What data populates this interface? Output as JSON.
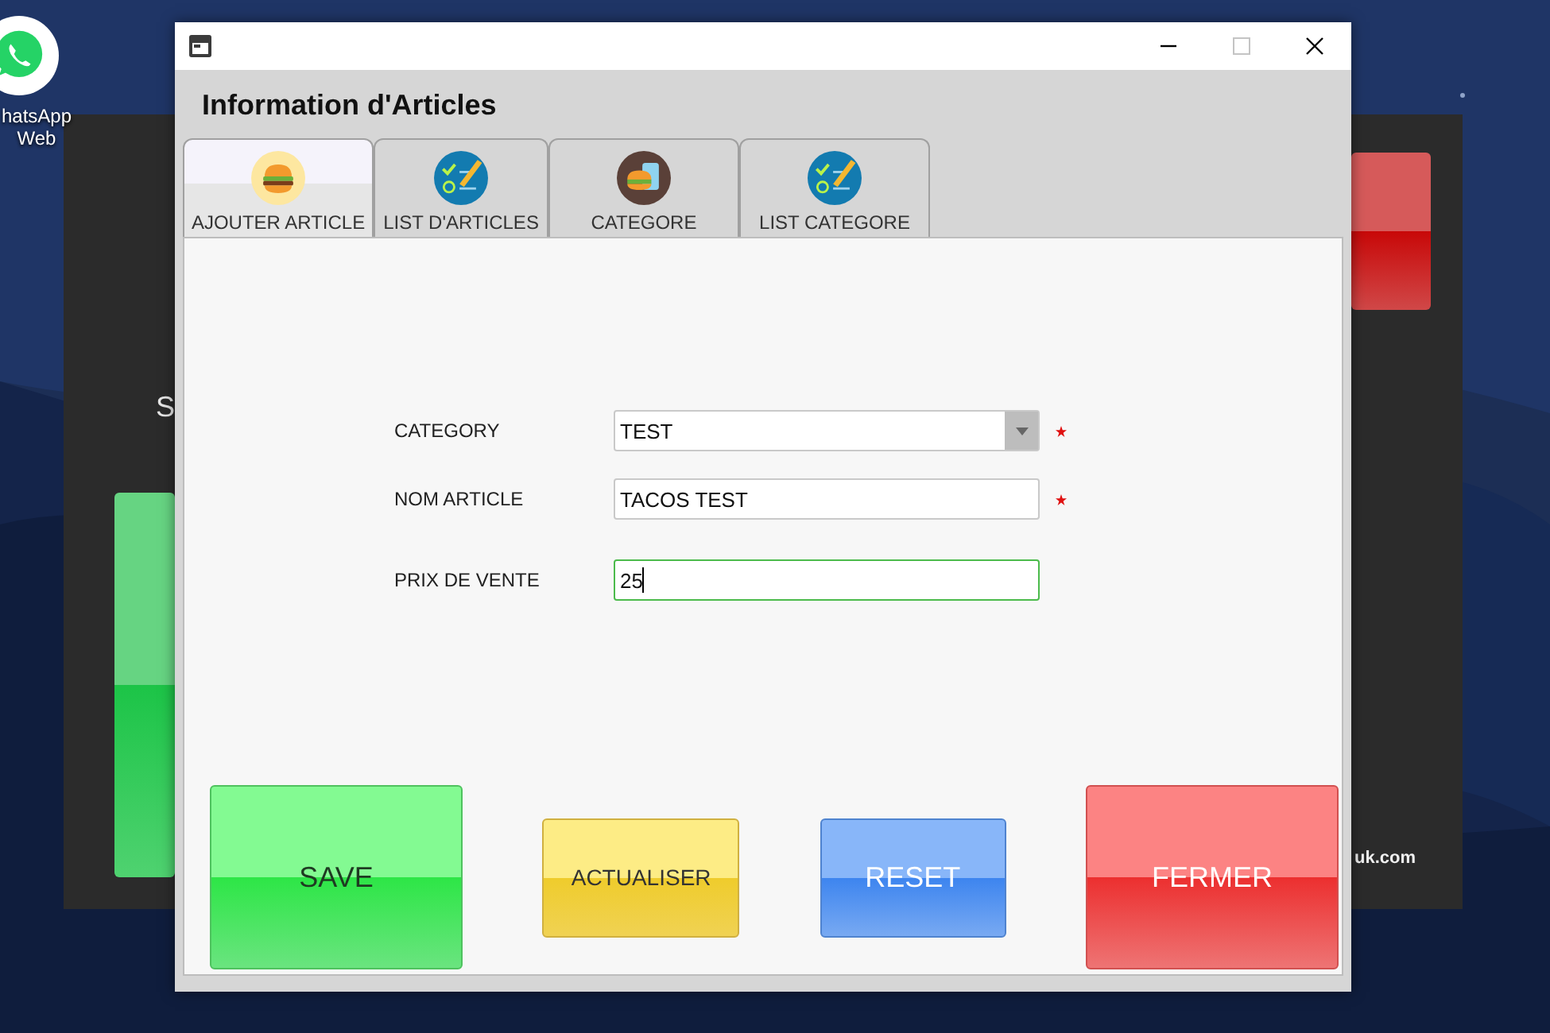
{
  "desktop": {
    "shortcut": {
      "label_lines": [
        "hatsApp",
        "Web"
      ]
    }
  },
  "background_window": {
    "subtitle": "S",
    "footer": "uk.com"
  },
  "window": {
    "title": "Information d'Articles",
    "tabs": [
      {
        "label": "AJOUTER ARTICLE",
        "kind": "burger",
        "selected": true
      },
      {
        "label": "LIST D'ARTICLES",
        "kind": "checklist",
        "selected": false
      },
      {
        "label": "CATEGORE",
        "kind": "category",
        "selected": false
      },
      {
        "label": "LIST CATEGORE",
        "kind": "checklist",
        "selected": false
      }
    ],
    "fields": [
      {
        "kind": "dropdown",
        "label": "CATEGORY",
        "value": "TEST",
        "required": true,
        "focused": false
      },
      {
        "kind": "text",
        "label": "NOM ARTICLE",
        "value": "TACOS TEST",
        "required": true,
        "focused": false
      },
      {
        "kind": "text",
        "label": "PRIX DE VENTE",
        "value": "25",
        "required": false,
        "focused": true
      }
    ],
    "buttons": [
      {
        "kind": "save",
        "label": "SAVE"
      },
      {
        "kind": "update",
        "label": "ACTUALISER"
      },
      {
        "kind": "reset",
        "label": "RESET"
      },
      {
        "kind": "close",
        "label": "FERMER"
      }
    ]
  }
}
